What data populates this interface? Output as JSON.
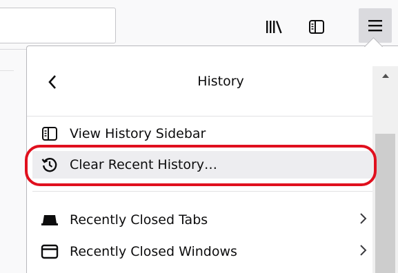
{
  "toolbar": {
    "library_icon": "library-icon",
    "sidebar_icon": "sidebar-icon",
    "menu_icon": "hamburger-menu-icon"
  },
  "panel": {
    "title": "History",
    "back_icon": "chevron-left-icon",
    "items": [
      {
        "label": "View History Sidebar",
        "icon": "sidebar-icon"
      },
      {
        "label": "Clear Recent History…",
        "icon": "history-clock-icon"
      },
      {
        "label": "Recently Closed Tabs",
        "icon": "tab-icon",
        "has_submenu": true
      },
      {
        "label": "Recently Closed Windows",
        "icon": "window-icon",
        "has_submenu": true
      }
    ]
  },
  "colors": {
    "highlight_ring": "#e0101e",
    "hover_bg": "#ededf0"
  }
}
